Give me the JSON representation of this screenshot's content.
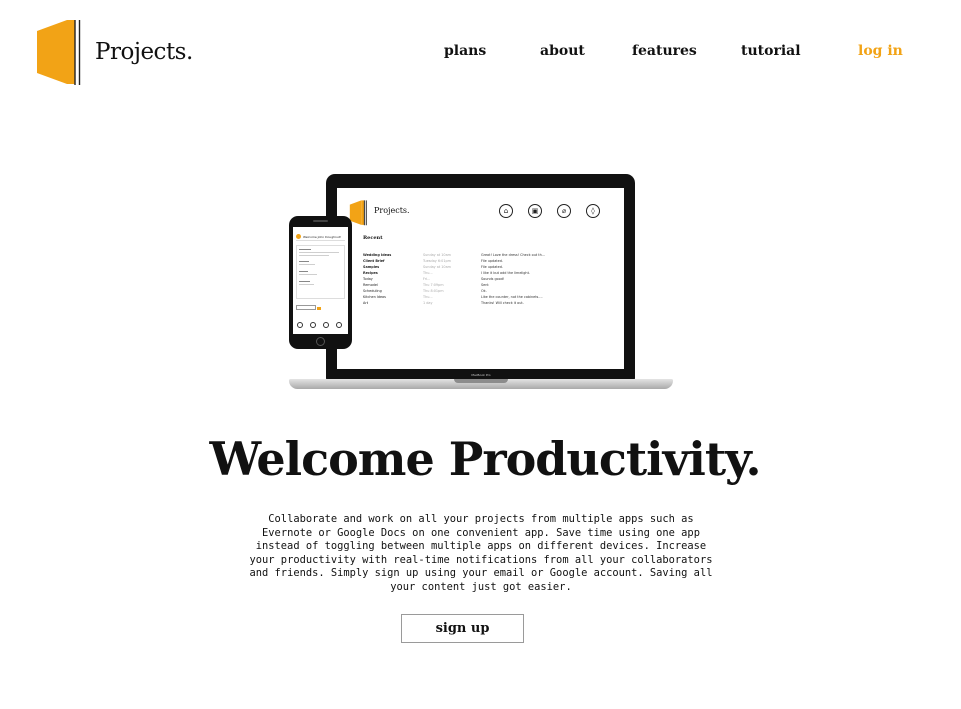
{
  "header": {
    "brand": "Projects.",
    "brand_color": "#f2a316",
    "logo_icon": "book-logo-icon",
    "nav": [
      {
        "label": "plans"
      },
      {
        "label": "about"
      },
      {
        "label": "features"
      },
      {
        "label": "tutorial"
      },
      {
        "label": "log in",
        "color": "#f2a316"
      }
    ]
  },
  "illustration": {
    "laptop": {
      "brand": "Projects.",
      "icons": [
        "home-icon",
        "camera-icon",
        "attach-icon",
        "drop-icon"
      ],
      "section_title": "Recent",
      "label": "MacBook Pro",
      "rows": [
        {
          "name": "Wedding Ideas",
          "date": "Sunday at 10am",
          "note": "Great! Love the dress! Check out th..."
        },
        {
          "name": "Client Brief",
          "date": "Tuesday 6:01pm",
          "note": "File updated."
        },
        {
          "name": "Samples",
          "date": "Sunday at 10am",
          "note": "File updated."
        },
        {
          "name": "Recipes",
          "date": "Thu...",
          "note": "I like it but add the limelight."
        },
        {
          "name": "Today",
          "date": "Fri...",
          "note": "Sounds good!"
        },
        {
          "name": "Remodel",
          "date": "Thu 7:09pm",
          "note": "Sent"
        },
        {
          "name": "Scheduling",
          "date": "Thu 8:01pm",
          "note": "Ok."
        },
        {
          "name": "Kitchen Ideas",
          "date": "Thu...",
          "note": "Like the counter, not the cabinets...."
        },
        {
          "name": "Art",
          "date": "1 day",
          "note": "Thanks! Will check it out."
        }
      ]
    },
    "phone": {
      "title": "Welcome John Doughnut!"
    }
  },
  "hero": {
    "headline": "Welcome Productivity.",
    "description": "Collaborate and work on all your projects from multiple apps such as Evernote or Google Docs on one convenient app. Save time using one app instead of toggling between multiple apps on different devices. Increase your productivity with real-time notifications from all your collaborators and friends. Simply sign up using your email or Google account. Saving all your content just got easier.",
    "cta_label": "sign up"
  }
}
